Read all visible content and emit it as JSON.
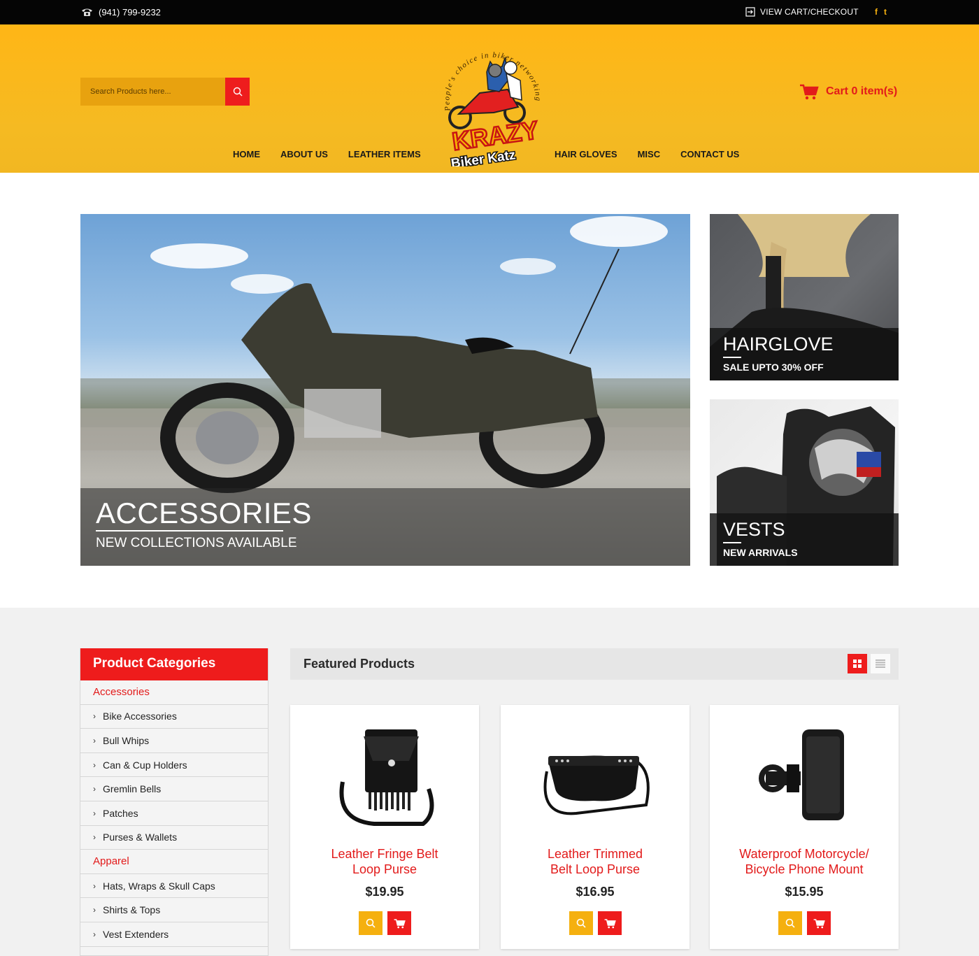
{
  "topbar": {
    "phone": "(941) 799-9232",
    "view_cart": "VIEW CART/CHECKOUT",
    "facebook": "f",
    "twitter": "t",
    "icons": [
      "phone-icon",
      "checkout-icon",
      "facebook-icon",
      "twitter-icon"
    ]
  },
  "header": {
    "search_placeholder": "Search Products here...",
    "cart_label": "Cart 0 item(s)",
    "logo_text": {
      "arc": "People's choice in biker networking",
      "brand_top": "KRAZY",
      "brand_bottom": "Biker Katz"
    },
    "nav_left": [
      "HOME",
      "ABOUT US",
      "LEATHER ITEMS"
    ],
    "nav_right": [
      "HAIR GLOVES",
      "MISC",
      "CONTACT US"
    ]
  },
  "banners": {
    "main": {
      "title": "ACCESSORIES",
      "subtitle": "NEW COLLECTIONS AVAILABLE"
    },
    "hair": {
      "title": "HAIRGLOVE",
      "subtitle": "SALE UPTO 30% OFF"
    },
    "vest": {
      "title": "VESTS",
      "subtitle": "NEW ARRIVALS"
    }
  },
  "categories": {
    "heading": "Product Categories",
    "items": [
      {
        "label": "Accessories",
        "group": true
      },
      {
        "label": "Bike Accessories",
        "group": false
      },
      {
        "label": "Bull Whips",
        "group": false
      },
      {
        "label": "Can & Cup Holders",
        "group": false
      },
      {
        "label": "Gremlin Bells",
        "group": false
      },
      {
        "label": "Patches",
        "group": false
      },
      {
        "label": "Purses & Wallets",
        "group": false
      },
      {
        "label": "Apparel",
        "group": true
      },
      {
        "label": "Hats, Wraps & Skull Caps",
        "group": false
      },
      {
        "label": "Shirts & Tops",
        "group": false
      },
      {
        "label": "Vest Extenders",
        "group": false
      }
    ]
  },
  "featured": {
    "title": "Featured Products",
    "products": [
      {
        "name_line1": "Leather Fringe Belt",
        "name_line2": "Loop Purse",
        "price": "$19.95"
      },
      {
        "name_line1": "Leather Trimmed",
        "name_line2": "Belt Loop Purse",
        "price": "$16.95"
      },
      {
        "name_line1": "Waterproof Motorcycle/",
        "name_line2": "Bicycle Phone Mount",
        "price": "$15.95"
      }
    ]
  },
  "colors": {
    "accent_red": "#ee1c1c",
    "header_yellow": "#f5b216",
    "topbar_black": "#050505"
  }
}
